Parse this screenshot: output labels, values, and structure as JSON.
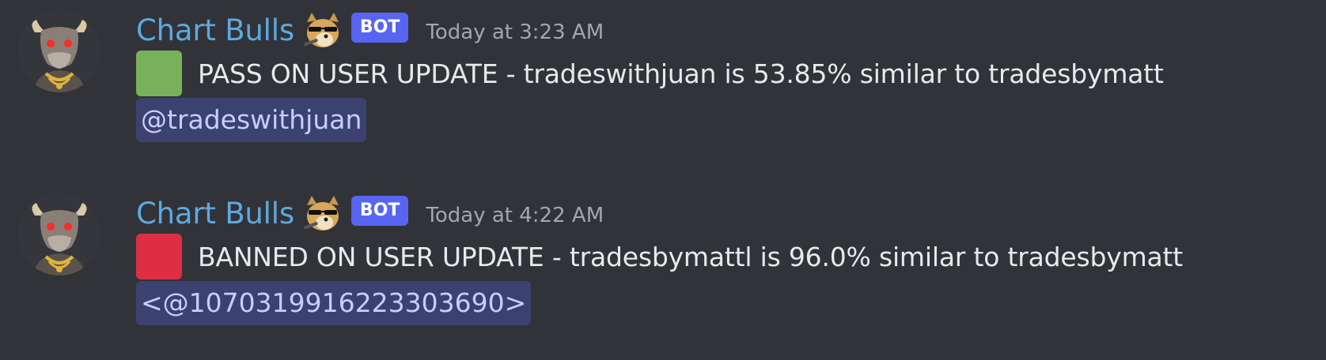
{
  "messages": [
    {
      "username": "Chart Bulls",
      "bot_tag": "BOT",
      "timestamp": "Today at 3:23 AM",
      "status_square": "green",
      "text": "PASS ON USER UPDATE - tradeswithjuan is 53.85% similar to tradesbymatt",
      "mention": "@tradeswithjuan"
    },
    {
      "username": "Chart Bulls",
      "bot_tag": "BOT",
      "timestamp": "Today at 4:22 AM",
      "status_square": "red",
      "text": "BANNED ON USER UPDATE - tradesbymattl is 96.0% similar to tradesbymatt",
      "mention": "<@1070319916223303690>"
    }
  ],
  "colors": {
    "background": "#313338",
    "username": "#5da9e0",
    "bot_tag": "#5865f2",
    "timestamp": "#a2a6ad",
    "mention_bg": "#3c4270",
    "mention_text": "#c9cdfb",
    "pass_square": "#78b159",
    "banned_square": "#dd2e44"
  },
  "icons": {
    "avatar": "bull-avatar-icon",
    "badge": "doge-emoji-icon",
    "pass": "green-square-emoji",
    "banned": "red-square-emoji"
  }
}
